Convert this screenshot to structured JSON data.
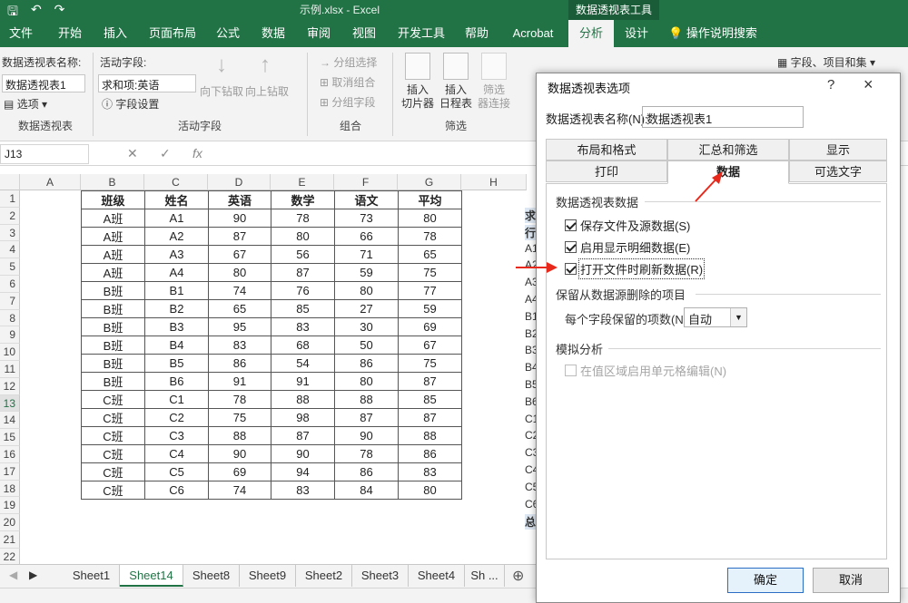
{
  "titlebar": {
    "doc_title": "示例.xlsx  -  Excel",
    "context_title": "数据透视表工具"
  },
  "menu": {
    "tabs": [
      "文件",
      "开始",
      "插入",
      "页面布局",
      "公式",
      "数据",
      "审阅",
      "视图",
      "开发工具",
      "帮助",
      "Acrobat",
      "分析",
      "设计"
    ],
    "tellme": "操作说明搜索"
  },
  "ribbon": {
    "pivot_name_label": "数据透视表名称:",
    "pivot_name_value": "数据透视表1",
    "options_label": "选项",
    "group1_label": "数据透视表",
    "active_field_label": "活动字段:",
    "active_field_value": "求和项:英语",
    "field_settings_label": "字段设置",
    "drilldown": "向下钻取",
    "drillup": "向上钻取",
    "group2_label": "活动字段",
    "group_selection": "分组选择",
    "ungroup": "取消组合",
    "group_field": "分组字段",
    "group3_label": "组合",
    "insert_slicer": "插入\n切片器",
    "insert_timeline": "插入\n日程表",
    "filter_connections": "筛选\n器连接",
    "group4_label": "筛选",
    "fields_items_sets": "字段、项目和集"
  },
  "formula_bar": {
    "name_box": "J13",
    "fx": "fx"
  },
  "grid": {
    "columns": [
      "A",
      "B",
      "C",
      "D",
      "E",
      "F",
      "G",
      "H"
    ],
    "rows": [
      "1",
      "2",
      "3",
      "4",
      "5",
      "6",
      "7",
      "8",
      "9",
      "10",
      "11",
      "12",
      "13",
      "14",
      "15",
      "16",
      "17",
      "18",
      "19",
      "20",
      "21",
      "22"
    ],
    "header": [
      "班级",
      "姓名",
      "英语",
      "数学",
      "语文",
      "平均"
    ],
    "data": [
      [
        "A班",
        "A1",
        "90",
        "78",
        "73",
        "80"
      ],
      [
        "A班",
        "A2",
        "87",
        "80",
        "66",
        "78"
      ],
      [
        "A班",
        "A3",
        "67",
        "56",
        "71",
        "65"
      ],
      [
        "A班",
        "A4",
        "80",
        "87",
        "59",
        "75"
      ],
      [
        "B班",
        "B1",
        "74",
        "76",
        "80",
        "77"
      ],
      [
        "B班",
        "B2",
        "65",
        "85",
        "27",
        "59"
      ],
      [
        "B班",
        "B3",
        "95",
        "83",
        "30",
        "69"
      ],
      [
        "B班",
        "B4",
        "83",
        "68",
        "50",
        "67"
      ],
      [
        "B班",
        "B5",
        "86",
        "54",
        "86",
        "75"
      ],
      [
        "B班",
        "B6",
        "91",
        "91",
        "80",
        "87"
      ],
      [
        "C班",
        "C1",
        "78",
        "88",
        "88",
        "85"
      ],
      [
        "C班",
        "C2",
        "75",
        "98",
        "87",
        "87"
      ],
      [
        "C班",
        "C3",
        "88",
        "87",
        "90",
        "88"
      ],
      [
        "C班",
        "C4",
        "90",
        "90",
        "78",
        "86"
      ],
      [
        "C班",
        "C5",
        "69",
        "94",
        "86",
        "83"
      ],
      [
        "C班",
        "C6",
        "74",
        "83",
        "84",
        "80"
      ]
    ],
    "pivot_partial": [
      "求",
      "行",
      "A1",
      "A2",
      "A3",
      "A4",
      "B1",
      "B2",
      "B3",
      "B4",
      "B5",
      "B6",
      "C1",
      "C2",
      "C3",
      "C4",
      "C5",
      "C6",
      "总"
    ]
  },
  "sheets": {
    "tabs": [
      "Sheet1",
      "Sheet14",
      "Sheet8",
      "Sheet9",
      "Sheet2",
      "Sheet3",
      "Sheet4",
      "Sh ..."
    ],
    "active": "Sheet14"
  },
  "dialog": {
    "title": "数据透视表选项",
    "help": "?",
    "close": "×",
    "name_label": "数据透视表名称(N):",
    "name_value": "数据透视表1",
    "tabs_top": [
      "布局和格式",
      "汇总和筛选",
      "显示"
    ],
    "tabs_bottom": [
      "打印",
      "数据",
      "可选文字"
    ],
    "section_data": "数据透视表数据",
    "cb_save_source": "保存文件及源数据(S)",
    "cb_enable_show_details": "启用显示明细数据(E)",
    "cb_refresh_on_open": "打开文件时刷新数据(R)",
    "section_retain": "保留从数据源删除的项目",
    "retain_label": "每个字段保留的项数(N):",
    "retain_value": "自动",
    "section_whatif": "模拟分析",
    "cb_enable_cell_edit": "在值区域启用单元格编辑(N)",
    "ok": "确定",
    "cancel": "取消"
  },
  "colors": {
    "excel_green": "#217346",
    "annotation_red": "#e8281b"
  }
}
